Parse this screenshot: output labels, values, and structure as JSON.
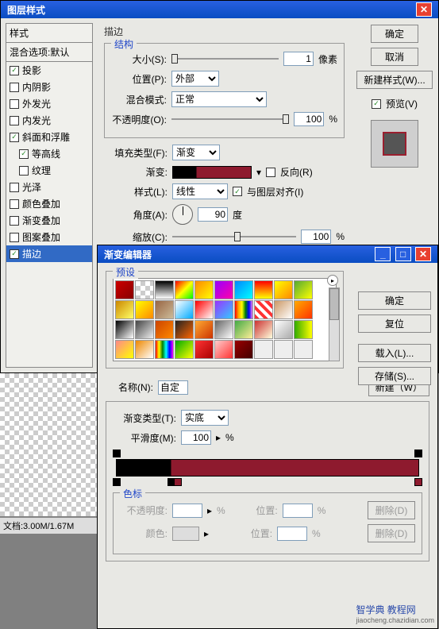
{
  "layerStyle": {
    "title": "图层样式",
    "stylesHeader": "样式",
    "blendDefault": "混合选项:默认",
    "effects": {
      "dropShadow": "投影",
      "innerShadow": "内阴影",
      "outerGlow": "外发光",
      "innerGlow": "内发光",
      "bevel": "斜面和浮雕",
      "contour": "等高线",
      "texture": "纹理",
      "satin": "光泽",
      "colorOverlay": "颜色叠加",
      "gradOverlay": "渐变叠加",
      "patternOverlay": "图案叠加",
      "stroke": "描边"
    },
    "groupStroke": "描边",
    "structLabel": "结构",
    "size": {
      "label": "大小(S):",
      "value": "1",
      "unit": "像素"
    },
    "position": {
      "label": "位置(P):",
      "value": "外部"
    },
    "blendMode": {
      "label": "混合模式:",
      "value": "正常"
    },
    "opacity": {
      "label": "不透明度(O):",
      "value": "100",
      "unit": "%"
    },
    "fillType": {
      "label": "填充类型(F):",
      "value": "渐变"
    },
    "gradient": {
      "label": "渐变:",
      "reverse": "反向(R)"
    },
    "style": {
      "label": "样式(L):",
      "value": "线性",
      "align": "与图层对齐(I)"
    },
    "angle": {
      "label": "角度(A):",
      "value": "90",
      "unit": "度"
    },
    "scale": {
      "label": "缩放(C):",
      "value": "100",
      "unit": "%"
    },
    "buttons": {
      "ok": "确定",
      "cancel": "取消",
      "newStyle": "新建样式(W)...",
      "preview": "预览(V)"
    }
  },
  "gradEditor": {
    "title": "渐变编辑器",
    "presetsLabel": "预设",
    "buttons": {
      "ok": "确定",
      "reset": "复位",
      "load": "载入(L)...",
      "save": "存储(S)...",
      "new": "新建（W）"
    },
    "name": {
      "label": "名称(N):",
      "value": "自定"
    },
    "gradType": {
      "label": "渐变类型(T):",
      "value": "实底"
    },
    "smooth": {
      "label": "平滑度(M):",
      "value": "100",
      "unit": "%"
    },
    "stopsLabel": "色标",
    "opacityStop": {
      "label": "不透明度:",
      "unit": "%",
      "posLabel": "位置:",
      "posUnit": "%",
      "delete": "删除(D)"
    },
    "colorStop": {
      "label": "颜色:",
      "posLabel": "位置:",
      "posUnit": "%",
      "delete": "删除(D)"
    }
  },
  "status": "文档:3.00M/1.67M",
  "watermark": "智学典 教程网",
  "watermark2": "jiaocheng.chazidian.com"
}
